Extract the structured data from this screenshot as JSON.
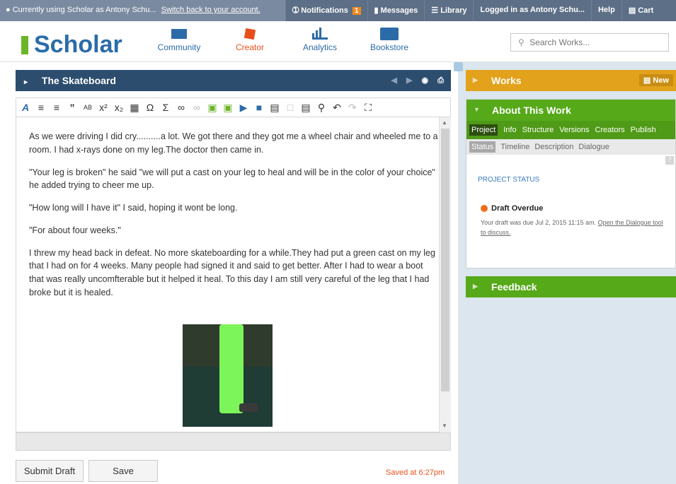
{
  "topbar": {
    "impersonation_text": "Currently using Scholar as Antony Schu...",
    "switch_link": "Switch back to your account.",
    "notifications_label": "Notifications",
    "notifications_count": "1",
    "messages_label": "Messages",
    "library_label": "Library",
    "logged_in_label": "Logged in as Antony Schu...",
    "help_label": "Help",
    "cart_label": "Cart"
  },
  "header": {
    "logo": "Scholar",
    "nav": [
      {
        "label": "Community",
        "icon": "community-icon"
      },
      {
        "label": "Creator",
        "icon": "creator-icon"
      },
      {
        "label": "Analytics",
        "icon": "analytics-icon"
      },
      {
        "label": "Bookstore",
        "icon": "bookstore-icon"
      }
    ],
    "search_placeholder": "Search Works..."
  },
  "editor": {
    "title": "The Skateboard",
    "paragraphs": [
      "As we were driving I did cry..........a lot. We got there and they got me a wheel chair and wheeled me to a room. I had x-rays done on my leg.The doctor then came in.",
      "\"Your leg is broken\" he said \"we will put a cast on your leg to heal and will be in the color of your choice\" he added trying to cheer me up.",
      "\"How long will I have it\" I said, hoping it wont be long.",
      "\"For about four weeks.\"",
      "I threw my head back in defeat. No more skateboarding for a while.They had put a green cast on my leg that I had on for 4 weeks. Many people had signed it and said to get better. After I had to wear a boot that was really uncomfterable but it helped it heal. To this day I am still very careful of the leg that I had broke but it is healed."
    ],
    "submit_label": "Submit Draft",
    "save_label": "Save",
    "saved_status": "Saved at 6:27pm"
  },
  "panels": {
    "works_title": "Works",
    "works_new": "New",
    "about_title": "About This Work",
    "tabs_primary": [
      "Project",
      "Info",
      "Structure",
      "Versions",
      "Creators",
      "Publish"
    ],
    "tabs_secondary": [
      "Status",
      "Timeline",
      "Description",
      "Dialogue"
    ],
    "project_status_label": "PROJECT STATUS",
    "draft_status": "Draft Overdue",
    "draft_message": "Your draft was due Jul 2, 2015 11:15 am.",
    "draft_link": "Open the Dialogue tool to discuss.",
    "feedback_title": "Feedback"
  },
  "colors": {
    "topbar": "#5d6f86",
    "brand_blue": "#2b6ca8",
    "works_orange": "#e3a21b",
    "panel_green": "#56a919",
    "saved_orange": "#e8511b"
  }
}
